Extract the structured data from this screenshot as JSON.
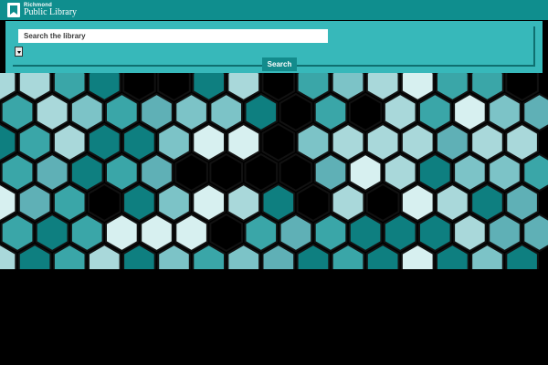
{
  "header": {
    "logo": {
      "line1": "Richmond",
      "line2": "Public Library"
    }
  },
  "search": {
    "placeholder": "Search the library",
    "value": "",
    "button_label": "Search"
  },
  "icons": {
    "logo": "library-logo-icon",
    "dropdown": "chevron-down-icon"
  },
  "colors": {
    "header": "#0f8e8e",
    "panel": "#37b8ba",
    "button": "#138b8c",
    "hex_palette": [
      "#0e7f80",
      "#3aa6a8",
      "#7cc3c7",
      "#a9d8da",
      "#d7f0f0",
      "#5fb0b6",
      "#000000"
    ]
  }
}
